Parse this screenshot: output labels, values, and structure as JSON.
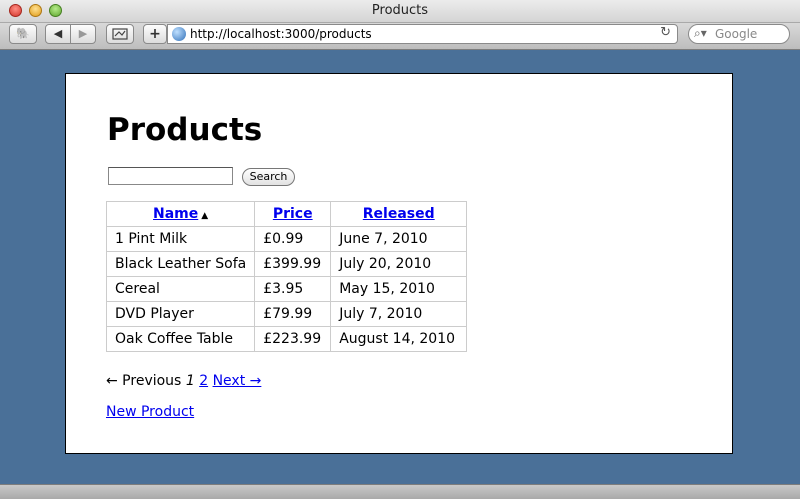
{
  "window": {
    "title": "Products"
  },
  "toolbar": {
    "url": "http://localhost:3000/products",
    "search_placeholder": "Google",
    "back_symbol": "◀",
    "forward_symbol": "▶",
    "add_symbol": "+",
    "reload_symbol": "↻"
  },
  "page": {
    "heading": "Products",
    "search_value": "",
    "search_button": "Search",
    "table": {
      "headers": [
        "Name",
        "Price",
        "Released"
      ],
      "sort_indicator": "▲",
      "rows": [
        [
          "1 Pint Milk",
          "£0.99",
          "June 7, 2010"
        ],
        [
          "Black Leather Sofa",
          "£399.99",
          "July 20, 2010"
        ],
        [
          "Cereal",
          "£3.95",
          "May 15, 2010"
        ],
        [
          "DVD Player",
          "£79.99",
          "July 7, 2010"
        ],
        [
          "Oak Coffee Table",
          "£223.99",
          "August 14, 2010"
        ]
      ]
    },
    "pagination": {
      "previous": "← Previous",
      "current": "1",
      "page2": "2",
      "next": "Next →"
    },
    "new_product_link": "New Product"
  },
  "colors": {
    "desktop_bg": "#4a7098",
    "link": "#0000ee"
  }
}
